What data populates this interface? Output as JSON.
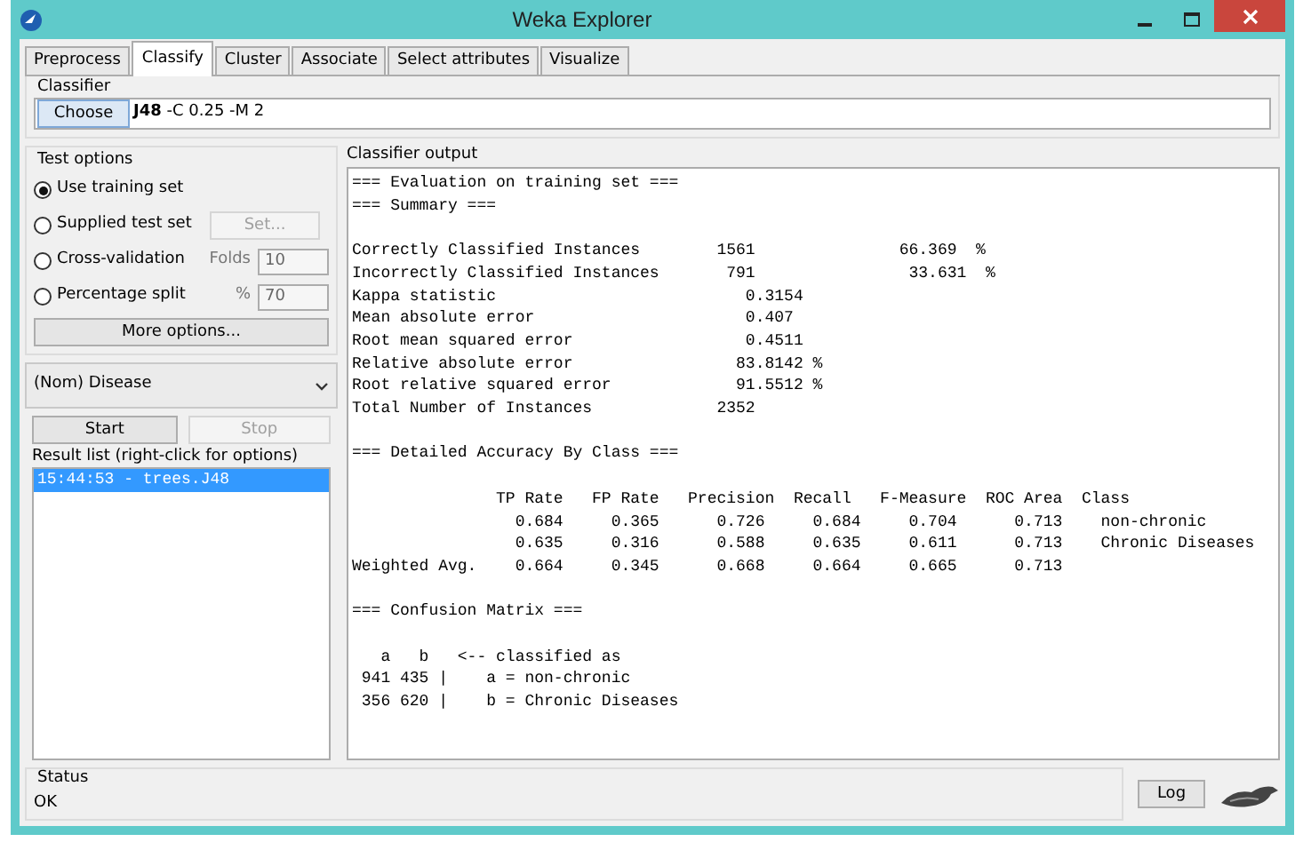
{
  "window": {
    "title": "Weka Explorer"
  },
  "tabs": [
    {
      "label": "Preprocess",
      "selected": false
    },
    {
      "label": "Classify",
      "selected": true
    },
    {
      "label": "Cluster",
      "selected": false
    },
    {
      "label": "Associate",
      "selected": false
    },
    {
      "label": "Select attributes",
      "selected": false
    },
    {
      "label": "Visualize",
      "selected": false
    }
  ],
  "classifier": {
    "heading": "Classifier",
    "button": "Choose",
    "value": "**J48** -C 0.25 -M 2"
  },
  "test_options": {
    "heading": "Test options",
    "options": [
      {
        "kind": "plain",
        "label": "Use training set",
        "selected": true
      },
      {
        "kind": "button",
        "label": "Supplied test set",
        "selected": false,
        "button": "Set...",
        "disabled": true
      },
      {
        "kind": "field",
        "label": "Cross-validation",
        "selected": false,
        "field_label": "Folds",
        "value": "10"
      },
      {
        "kind": "field",
        "label": "Percentage split",
        "selected": false,
        "field_label": "%",
        "value": "70"
      }
    ],
    "more_button": "More options..."
  },
  "class_select": {
    "value": "(Nom) Disease"
  },
  "start_button": {
    "label": "Start",
    "disabled": false
  },
  "stop_button": {
    "label": "Stop",
    "disabled": true
  },
  "result_list": {
    "heading": "Result list (right-click for options)",
    "items": [
      {
        "label": "15:44:53 - trees.J48",
        "selected": true
      }
    ]
  },
  "output": {
    "heading": "Classifier output",
    "blocks": [
      [
        "=== Evaluation on training set ===",
        "=== Summary ==="
      ],
      [
        "Correctly Classified Instances        1561               66.369  %",
        "Incorrectly Classified Instances       791                33.631  %",
        "Kappa statistic                          0.3154",
        "Mean absolute error                      0.407",
        "Root mean squared error                  0.4511",
        "Relative absolute error                 83.8142 %",
        "Root relative squared error             91.5512 %",
        "Total Number of Instances             2352"
      ],
      [
        "=== Detailed Accuracy By Class ==="
      ],
      [
        "               TP Rate   FP Rate   Precision  Recall   F-Measure  ROC Area  Class",
        "                 0.684     0.365      0.726     0.684     0.704      0.713    non-chronic",
        "                 0.635     0.316      0.588     0.635     0.611      0.713    Chronic Diseases",
        "Weighted Avg.    0.664     0.345      0.668     0.664     0.665      0.713"
      ],
      [
        "=== Confusion Matrix ==="
      ],
      [
        "   a   b   <-- classified as",
        " 941 435 |    a = non-chronic",
        " 356 620 |    b = Chronic Diseases"
      ]
    ]
  },
  "status": {
    "heading": "Status",
    "text": "OK",
    "log_button": "Log"
  }
}
